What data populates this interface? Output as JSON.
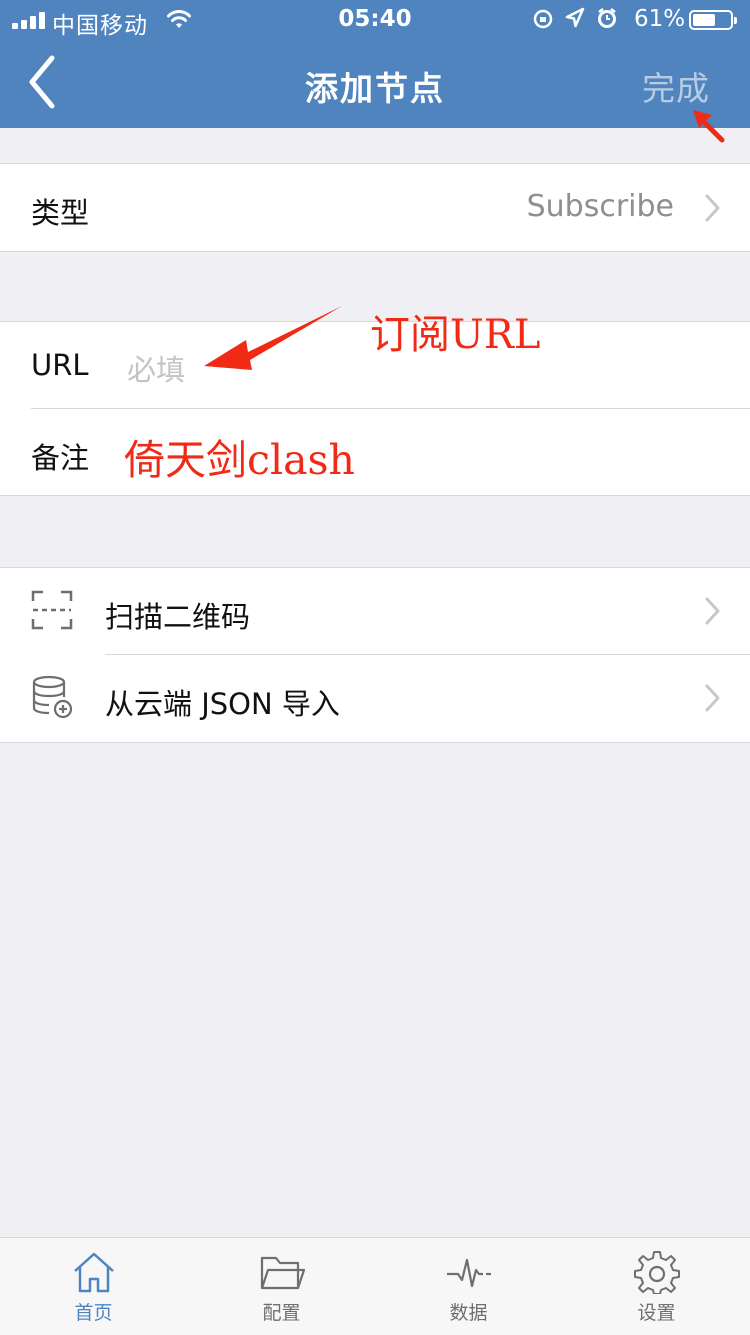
{
  "status_bar": {
    "carrier": "中国移动",
    "time": "05:40",
    "battery": "61%",
    "battery_level": 0.61
  },
  "nav": {
    "title": "添加节点",
    "done_label": "完成",
    "back_icon": "chevron-left-icon"
  },
  "type_row": {
    "label": "类型",
    "value": "Subscribe"
  },
  "url_row": {
    "label": "URL",
    "placeholder": "必填"
  },
  "note_row": {
    "label": "备注"
  },
  "menu": [
    {
      "label": "扫描二维码",
      "icon": "scan-qr-icon"
    },
    {
      "label": "从云端 JSON 导入",
      "icon": "database-add-icon"
    }
  ],
  "annotations": {
    "url_hint": "订阅URL",
    "note_hint": "倚天剑clash",
    "color": "#f02a14"
  },
  "tabs": [
    {
      "label": "首页",
      "icon": "home-icon",
      "active": true
    },
    {
      "label": "配置",
      "icon": "folder-icon",
      "active": false
    },
    {
      "label": "数据",
      "icon": "pulse-icon",
      "active": false
    },
    {
      "label": "设置",
      "icon": "gear-icon",
      "active": false
    }
  ],
  "colors": {
    "accent": "#4f84bf",
    "background": "#efeff4"
  }
}
